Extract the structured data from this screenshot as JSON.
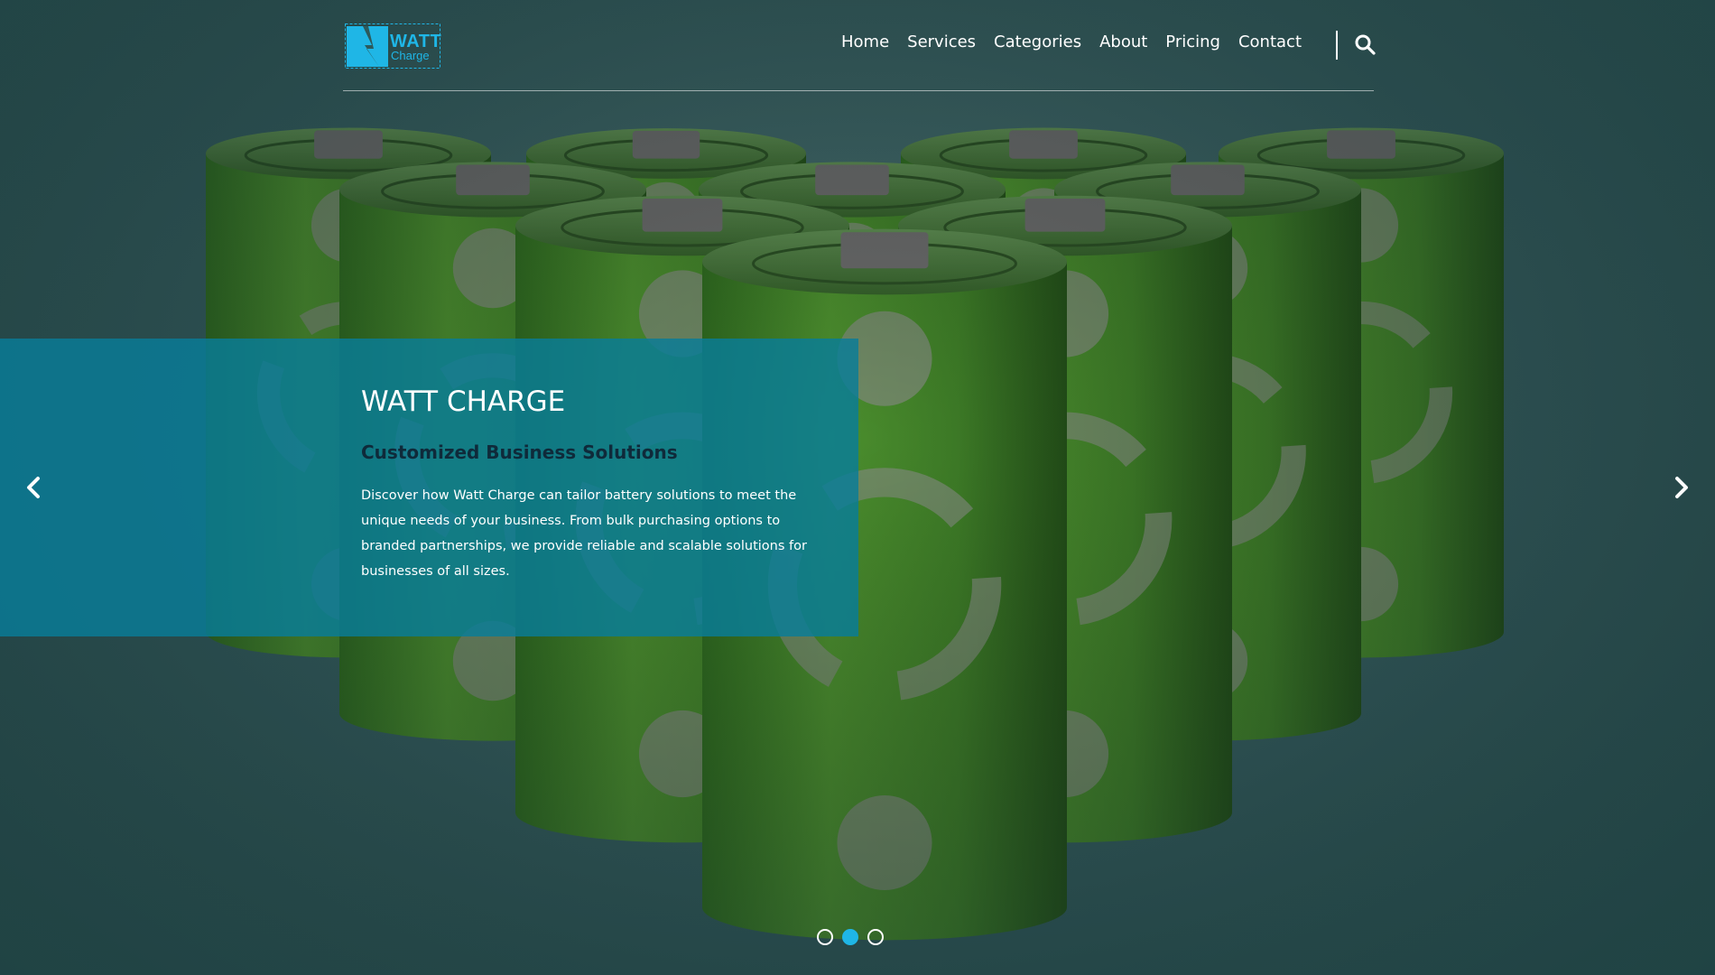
{
  "brand": {
    "name_line1": "WATT",
    "name_line2": "Charge",
    "color": "#1fb6e6"
  },
  "nav": {
    "items": [
      "Home",
      "Services",
      "Categories",
      "About",
      "Pricing",
      "Contact"
    ],
    "search_icon": "search-icon"
  },
  "hero": {
    "title": "WATT CHARGE",
    "subtitle": "Customized Business Solutions",
    "description": "Discover how Watt Charge can tailor battery solutions to meet the unique needs of your business. From bulk purchasing options to branded partnerships, we provide reliable and scalable solutions for businesses of all sizes.",
    "panel_color": "#087d98",
    "prev_icon": "chevron-left-icon",
    "next_icon": "chevron-right-icon"
  },
  "carousel": {
    "slide_count": 3,
    "active_index": 1
  }
}
